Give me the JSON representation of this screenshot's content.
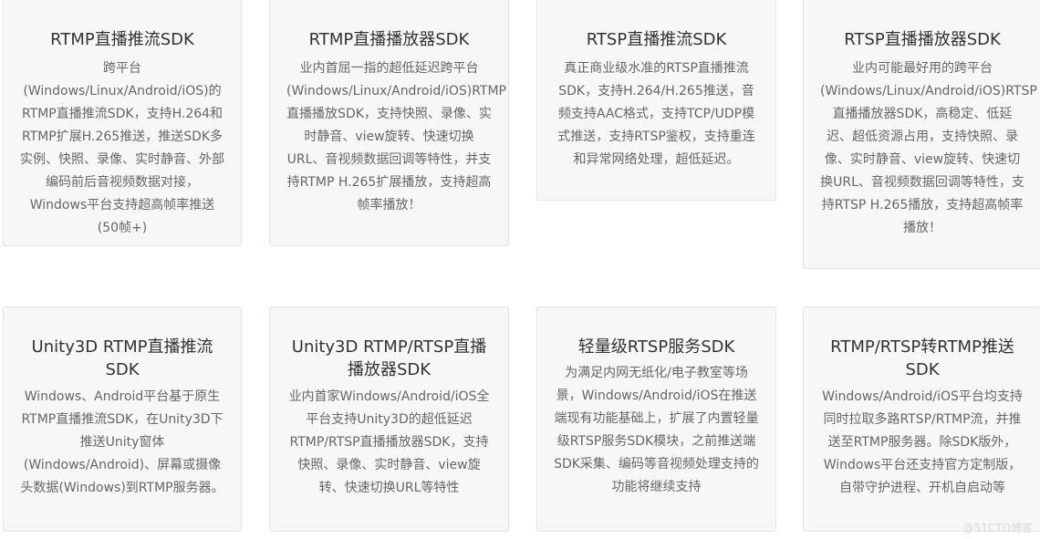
{
  "cards": [
    {
      "title": "RTMP直播推流SDK",
      "description": "跨平台(Windows/Linux/Android/iOS)的RTMP直播推流SDK，支持H.264和RTMP扩展H.265推送，推送SDK多实例、快照、录像、实时静音、外部编码前后音视频数据对接，Windows平台支持超高帧率推送(50帧+)"
    },
    {
      "title": "RTMP直播播放器SDK",
      "description": "业内首屈一指的超低延迟跨平台(Windows/Linux/Android/iOS)RTMP直播播放SDK，支持快照、录像、实时静音、view旋转、快速切换URL、音视频数据回调等特性，并支持RTMP H.265扩展播放，支持超高帧率播放！"
    },
    {
      "title": "RTSP直播推流SDK",
      "description": "真正商业级水准的RTSP直播推流SDK，支持H.264/H.265推送，音频支持AAC格式，支持TCP/UDP模式推送，支持RTSP鉴权，支持重连和异常网络处理，超低延迟。"
    },
    {
      "title": "RTSP直播播放器SDK",
      "description": "业内可能最好用的跨平台(Windows/Linux/Android/iOS)RTSP直播播放器SDK，高稳定、低延迟、超低资源占用，支持快照、录像、实时静音、view旋转、快速切换URL、音视频数据回调等特性，支持RTSP H.265播放，支持超高帧率播放！"
    },
    {
      "title": "Unity3D RTMP直播推流SDK",
      "description": "Windows、Android平台基于原生RTMP直播推流SDK，在Unity3D下推送Unity窗体(Windows/Android)、屏幕或摄像头数据(Windows)到RTMP服务器。"
    },
    {
      "title": "Unity3D RTMP/RTSP直播播放器SDK",
      "description": "业内首家Windows/Android/iOS全平台支持Unity3D的超低延迟RTMP/RTSP直播播放器SDK，支持快照、录像、实时静音、view旋转、快速切换URL等特性"
    },
    {
      "title": "轻量级RTSP服务SDK",
      "description": "为满足内网无纸化/电子教室等场景，Windows/Android/iOS在推送端现有功能基础上，扩展了内置轻量级RTSP服务SDK模块，之前推送端SDK采集、编码等音视频处理支持的功能将继续支持"
    },
    {
      "title": "RTMP/RTSP转RTMP推送SDK",
      "description": "Windows/Android/iOS平台均支持同时拉取多路RTSP/RTMP流，并推送至RTMP服务器。除SDK版外，Windows平台还支持官方定制版，自带守护进程、开机自启动等"
    }
  ],
  "watermark": "@51CTO博客"
}
